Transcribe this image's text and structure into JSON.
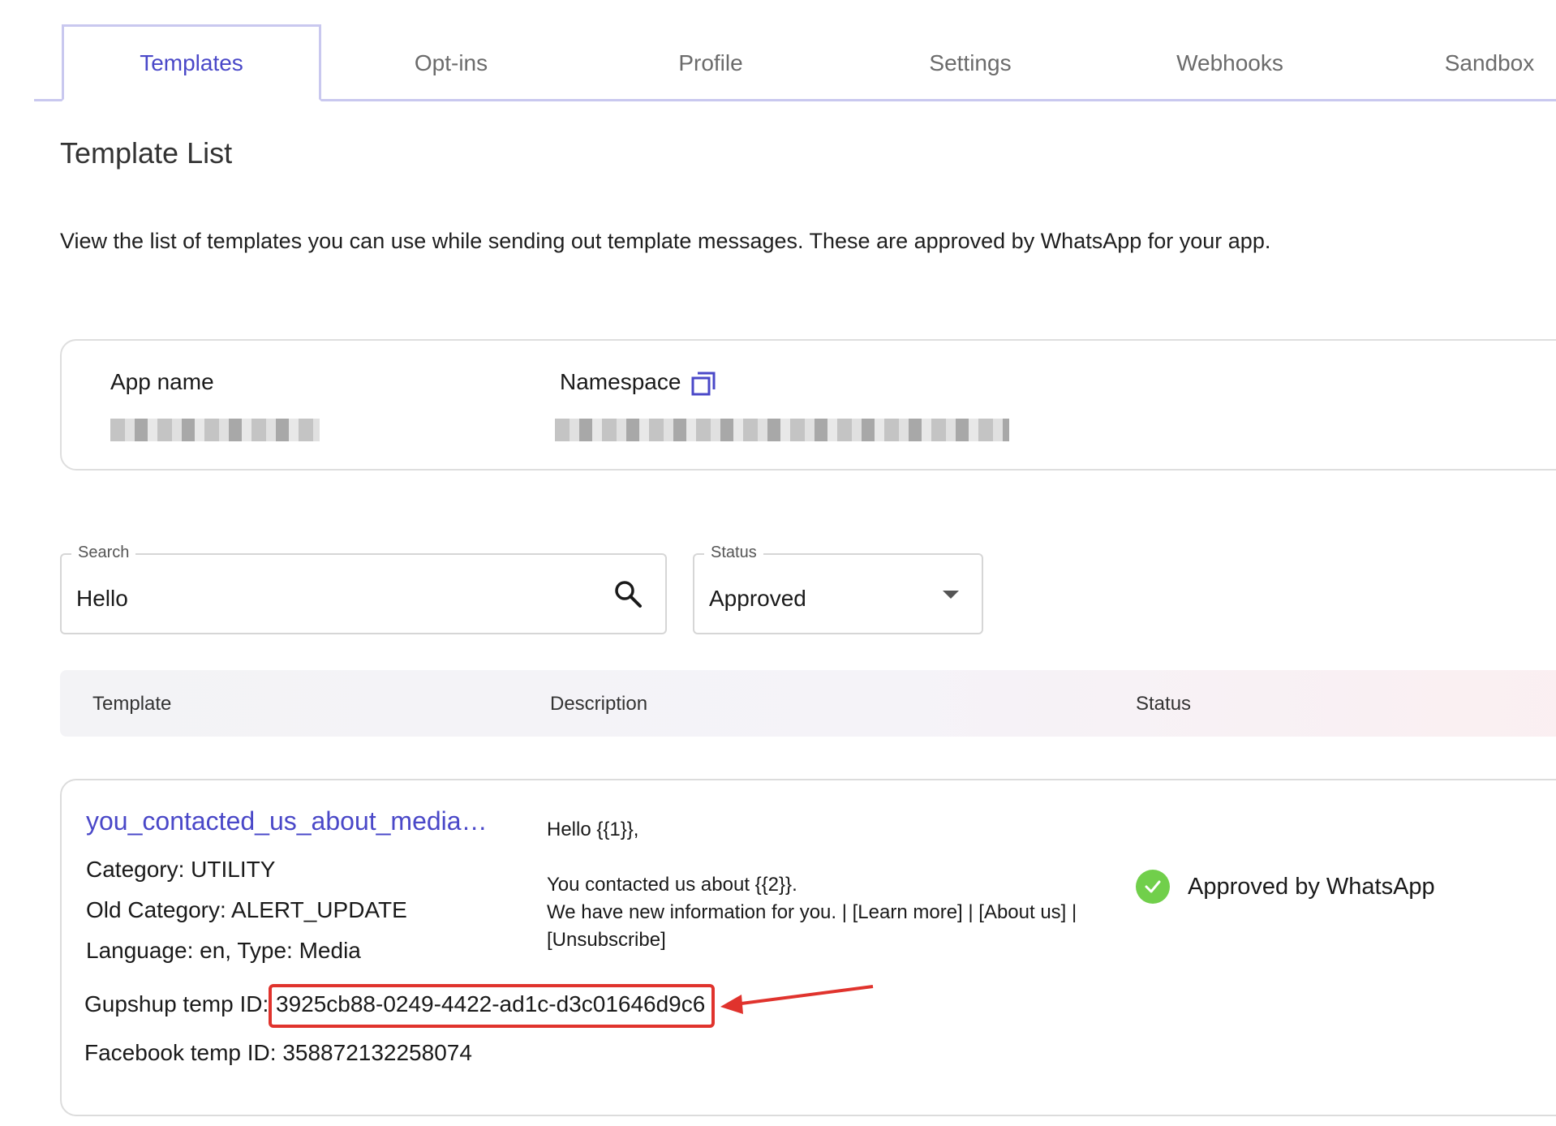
{
  "tabs": [
    {
      "label": "Templates"
    },
    {
      "label": "Opt-ins"
    },
    {
      "label": "Profile"
    },
    {
      "label": "Settings"
    },
    {
      "label": "Webhooks"
    },
    {
      "label": "Sandbox"
    }
  ],
  "page": {
    "title": "Template List",
    "intro": "View the list of templates you can use while sending out template messages. These are approved by WhatsApp for your app."
  },
  "app_info": {
    "app_name_label": "App name",
    "namespace_label": "Namespace"
  },
  "filters": {
    "search_label": "Search",
    "search_value": "Hello",
    "status_label": "Status",
    "status_value": "Approved"
  },
  "table": {
    "headers": [
      "Template",
      "Description",
      "Status"
    ]
  },
  "row": {
    "name": "you_contacted_us_about_media…",
    "category": "Category: UTILITY",
    "old_category": "Old Category: ALERT_UPDATE",
    "language_type": "Language: en, Type: Media",
    "gupshup_label": "Gupshup temp ID:",
    "gupshup_id": "3925cb88-0249-4422-ad1c-d3c01646d9c6",
    "facebook_id": "Facebook temp ID: 358872132258074",
    "description_lines": [
      "Hello {{1}},",
      "You contacted us about {{2}}.",
      "We have new information for you. | [Learn more] | [About us] |",
      "[Unsubscribe]"
    ],
    "status": "Approved by WhatsApp"
  },
  "colors": {
    "accent": "#4a48c8",
    "tab_border": "#c9c8ef",
    "approved_green": "#71cf4b",
    "highlight_red": "#e0332d"
  }
}
